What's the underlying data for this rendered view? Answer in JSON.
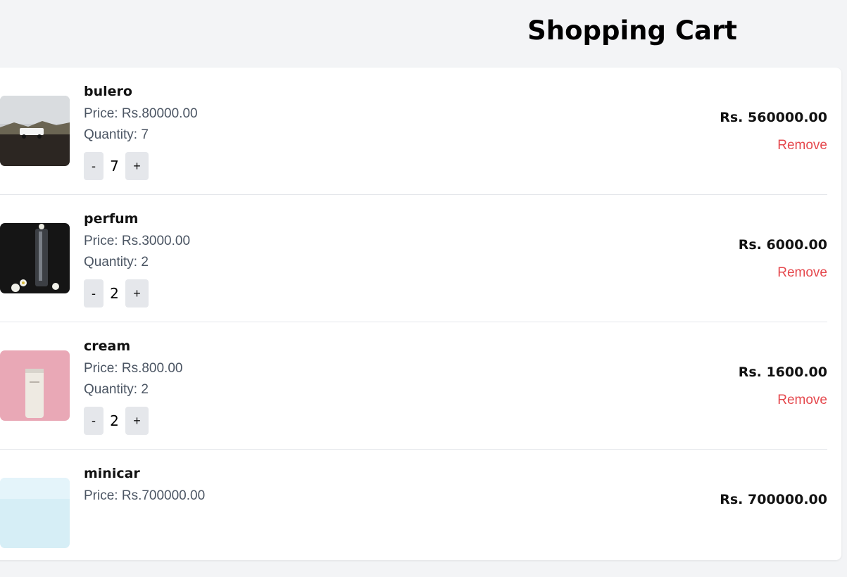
{
  "page": {
    "title": "Shopping Cart"
  },
  "remove_label": "Remove",
  "decrement_label": "-",
  "increment_label": "+",
  "colors": {
    "background": "#f3f4f6",
    "panel": "#ffffff",
    "remove": "#e5484d",
    "stepper": "#e5e7eb"
  },
  "items": [
    {
      "name": "bulero",
      "price": "Price: Rs.80000.00",
      "quantity_text": "Quantity: 7",
      "quantity": "7",
      "total": "Rs. 560000.00",
      "image": "suv-on-rocky-field"
    },
    {
      "name": "perfum",
      "price": "Price: Rs.3000.00",
      "quantity_text": "Quantity: 2",
      "quantity": "2",
      "total": "Rs. 6000.00",
      "image": "perfume-bottle-with-flowers"
    },
    {
      "name": "cream",
      "price": "Price: Rs.800.00",
      "quantity_text": "Quantity: 2",
      "quantity": "2",
      "total": "Rs. 1600.00",
      "image": "cream-tube-on-pink"
    },
    {
      "name": "minicar",
      "price": "Price: Rs.700000.00",
      "quantity_text": "",
      "quantity": "",
      "total": "Rs. 700000.00",
      "image": "light-blue-image"
    }
  ]
}
